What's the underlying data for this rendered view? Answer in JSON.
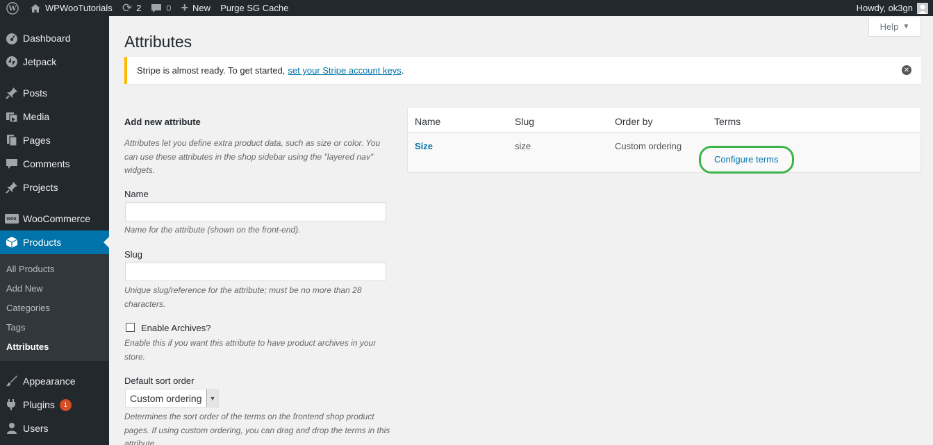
{
  "adminbar": {
    "site_name": "WPWooTutorials",
    "updates_count": "2",
    "comments_count": "0",
    "new_label": "New",
    "purge_label": "Purge SG Cache",
    "howdy": "Howdy, ok3gn"
  },
  "sidebar": {
    "items": [
      {
        "label": "Dashboard",
        "icon": "dashboard-icon"
      },
      {
        "label": "Jetpack",
        "icon": "jetpack-icon"
      },
      {
        "label": "Posts",
        "icon": "pin-icon"
      },
      {
        "label": "Media",
        "icon": "media-icon"
      },
      {
        "label": "Pages",
        "icon": "pages-icon"
      },
      {
        "label": "Comments",
        "icon": "comments-icon"
      },
      {
        "label": "Projects",
        "icon": "pin-icon"
      },
      {
        "label": "WooCommerce",
        "icon": "woo-icon"
      },
      {
        "label": "Products",
        "icon": "box-icon"
      },
      {
        "label": "Appearance",
        "icon": "brush-icon"
      },
      {
        "label": "Plugins",
        "icon": "plug-icon",
        "badge": "1"
      },
      {
        "label": "Users",
        "icon": "user-icon"
      }
    ],
    "woo_icon_text": "woo",
    "submenu": [
      "All Products",
      "Add New",
      "Categories",
      "Tags",
      "Attributes"
    ]
  },
  "page": {
    "title": "Attributes",
    "help_label": "Help"
  },
  "notice": {
    "text": "Stripe is almost ready. To get started,",
    "link": "set your Stripe account keys",
    "trailing": "."
  },
  "form": {
    "heading": "Add new attribute",
    "intro": "Attributes let you define extra product data, such as size or color. You can use these attributes in the shop sidebar using the \"layered nav\" widgets.",
    "name_label": "Name",
    "name_value": "",
    "name_desc": "Name for the attribute (shown on the front-end).",
    "slug_label": "Slug",
    "slug_value": "",
    "slug_desc": "Unique slug/reference for the attribute; must be no more than 28 characters.",
    "archives_label": "Enable Archives?",
    "archives_desc": "Enable this if you want this attribute to have product archives in your store.",
    "sort_label": "Default sort order",
    "sort_value": "Custom ordering",
    "sort_desc": "Determines the sort order of the terms on the frontend shop product pages. If using custom ordering, you can drag and drop the terms in this attribute."
  },
  "table": {
    "headers": [
      "Name",
      "Slug",
      "Order by",
      "Terms"
    ],
    "rows": [
      {
        "name": "Size",
        "slug": "size",
        "order_by": "Custom ordering",
        "terms_link": "Configure terms"
      }
    ]
  },
  "colors": {
    "admin_bar": "#23282d",
    "accent": "#0073aa",
    "notice_border": "#ffb900",
    "highlight": "#3bb54a",
    "badge": "#d54e21"
  }
}
